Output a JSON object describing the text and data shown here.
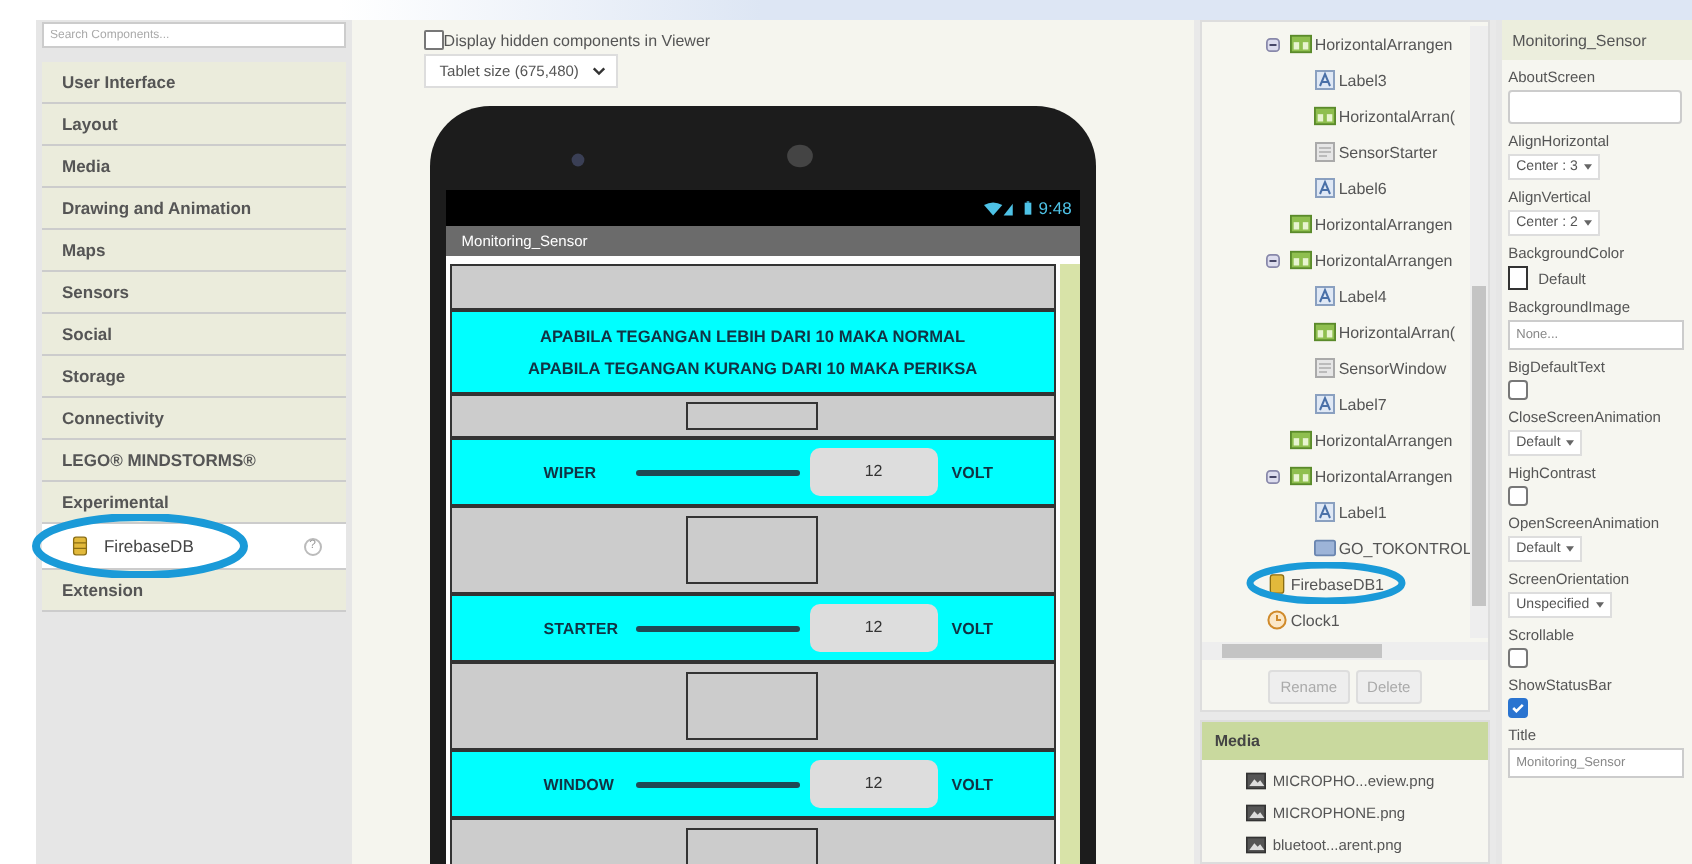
{
  "palette": {
    "search": {
      "placeholder": "Search Components..."
    },
    "categories": [
      {
        "label": "User Interface"
      },
      {
        "label": "Layout"
      },
      {
        "label": "Media"
      },
      {
        "label": "Drawing and Animation"
      },
      {
        "label": "Maps"
      },
      {
        "label": "Sensors"
      },
      {
        "label": "Social"
      },
      {
        "label": "Storage"
      },
      {
        "label": "Connectivity"
      },
      {
        "label": "LEGO® MINDSTORMS®"
      },
      {
        "label": "Experimental",
        "children": [
          {
            "label": "FirebaseDB",
            "help": "?"
          }
        ]
      },
      {
        "label": "Extension"
      }
    ]
  },
  "viewer": {
    "hidden_checkbox": {
      "label": "Display hidden components in Viewer",
      "checked": false
    },
    "size_select": {
      "value": "Tablet size (675,480)"
    },
    "phone": {
      "time": "9:48",
      "title": "Monitoring_Sensor",
      "rows": [
        {
          "kind": "spacer"
        },
        {
          "kind": "banner",
          "lines": [
            "APABILA TEGANGAN LEBIH DARI 10 MAKA NORMAL",
            "APABILA TEGANGAN KURANG DARI 10 MAKA PERIKSA"
          ]
        },
        {
          "kind": "gap"
        },
        {
          "kind": "sensor",
          "name": "WIPER",
          "value": "12",
          "unit": "VOLT"
        },
        {
          "kind": "box"
        },
        {
          "kind": "sensor",
          "name": "STARTER",
          "value": "12",
          "unit": "VOLT"
        },
        {
          "kind": "box"
        },
        {
          "kind": "sensor",
          "name": "WINDOW",
          "value": "12",
          "unit": "VOLT"
        },
        {
          "kind": "box"
        }
      ]
    }
  },
  "components": {
    "tree": [
      {
        "children": [
          {
            "label": "HorizontalArrangen",
            "kind": "arrangement",
            "expanded": true,
            "children": [
              {
                "label": "Label3",
                "kind": "label"
              },
              {
                "label": "HorizontalArran(",
                "kind": "arrangement"
              },
              {
                "label": "SensorStarter",
                "kind": "textbox"
              },
              {
                "label": "Label6",
                "kind": "label"
              }
            ]
          },
          {
            "label": "HorizontalArrangen",
            "kind": "arrangement"
          },
          {
            "label": "HorizontalArrangen",
            "kind": "arrangement",
            "expanded": true,
            "children": [
              {
                "label": "Label4",
                "kind": "label"
              },
              {
                "label": "HorizontalArran(",
                "kind": "arrangement"
              },
              {
                "label": "SensorWindow",
                "kind": "textbox"
              },
              {
                "label": "Label7",
                "kind": "label"
              }
            ]
          },
          {
            "label": "HorizontalArrangen",
            "kind": "arrangement"
          },
          {
            "label": "HorizontalArrangen",
            "kind": "arrangement",
            "expanded": true,
            "children": [
              {
                "label": "Label1",
                "kind": "label"
              },
              {
                "label": "GO_TOKONTROL",
                "kind": "button"
              }
            ]
          }
        ]
      },
      {
        "label": "FirebaseDB1",
        "kind": "firebase"
      },
      {
        "label": "Clock1",
        "kind": "clock"
      }
    ],
    "buttons": [
      {
        "label": "Rename",
        "disabled": true
      },
      {
        "label": "Delete",
        "disabled": true
      }
    ]
  },
  "media": {
    "title": "Media",
    "files": [
      "MICROPHO...eview.png",
      "MICROPHONE.png",
      "bluetoot...arent.png"
    ]
  },
  "properties": {
    "title": "Monitoring_Sensor",
    "items": [
      {
        "name": "AboutScreen",
        "kind": "textarea"
      },
      {
        "name": "AlignHorizontal",
        "kind": "dropdown",
        "value": "Center : 3"
      },
      {
        "name": "AlignVertical",
        "kind": "dropdown",
        "value": "Center : 2"
      },
      {
        "name": "BackgroundColor",
        "kind": "color",
        "value": "Default"
      },
      {
        "name": "BackgroundImage",
        "kind": "field",
        "value": "None..."
      },
      {
        "name": "BigDefaultText",
        "kind": "checkbox",
        "checked": false
      },
      {
        "name": "CloseScreenAnimation",
        "kind": "dropdown",
        "value": "Default"
      },
      {
        "name": "HighContrast",
        "kind": "checkbox",
        "checked": false
      },
      {
        "name": "OpenScreenAnimation",
        "kind": "dropdown",
        "value": "Default"
      },
      {
        "name": "ScreenOrientation",
        "kind": "dropdown",
        "value": "Unspecified"
      },
      {
        "name": "Scrollable",
        "kind": "checkbox",
        "checked": false
      },
      {
        "name": "ShowStatusBar",
        "kind": "checkbox",
        "checked": true
      },
      {
        "name": "Title",
        "kind": "field",
        "value": "Monitoring_Sensor"
      }
    ]
  }
}
